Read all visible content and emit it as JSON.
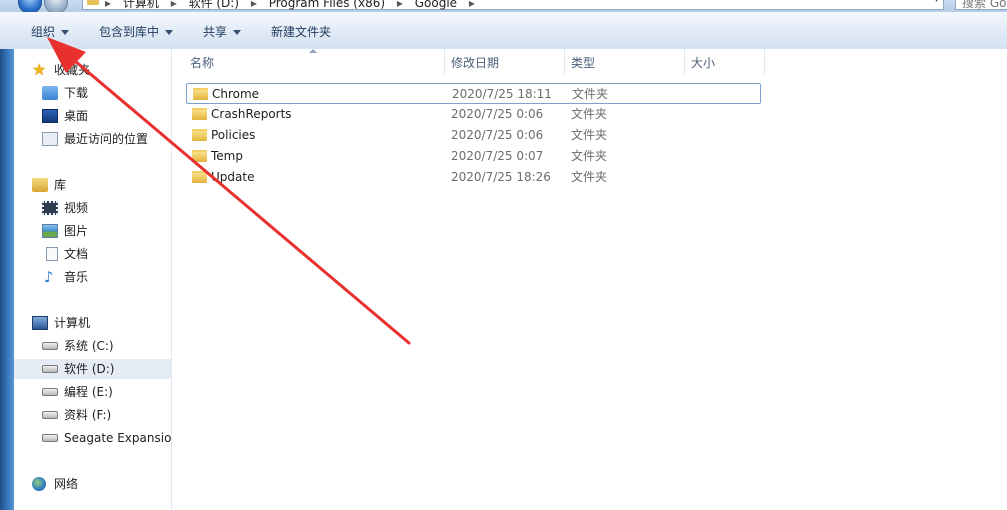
{
  "address": {
    "crumbs": [
      "计算机",
      "软件 (D:)",
      "Program Files (x86)",
      "Google"
    ],
    "separator": "▸"
  },
  "search": {
    "placeholder": "搜索 Go"
  },
  "toolbar": {
    "organize": "组织",
    "include_in_library": "包含到库中",
    "share": "共享",
    "new_folder": "新建文件夹"
  },
  "nav": {
    "favorites": "收藏夹",
    "downloads": "下载",
    "desktop": "桌面",
    "recent": "最近访问的位置",
    "libraries": "库",
    "videos": "视频",
    "pictures": "图片",
    "documents": "文档",
    "music": "音乐",
    "computer": "计算机",
    "drives": [
      {
        "label": "系统 (C:)"
      },
      {
        "label": "软件 (D:)"
      },
      {
        "label": "编程 (E:)"
      },
      {
        "label": "资料 (F:)"
      },
      {
        "label": "Seagate Expansion"
      }
    ],
    "network": "网络"
  },
  "columns": {
    "name": "名称",
    "modified": "修改日期",
    "type": "类型",
    "size": "大小"
  },
  "files": [
    {
      "name": "Chrome",
      "modified": "2020/7/25 18:11",
      "type": "文件夹"
    },
    {
      "name": "CrashReports",
      "modified": "2020/7/25 0:06",
      "type": "文件夹"
    },
    {
      "name": "Policies",
      "modified": "2020/7/25 0:06",
      "type": "文件夹"
    },
    {
      "name": "Temp",
      "modified": "2020/7/25 0:07",
      "type": "文件夹"
    },
    {
      "name": "Update",
      "modified": "2020/7/25 18:26",
      "type": "文件夹"
    }
  ],
  "colors": {
    "annotation_arrow": "#e8312f",
    "toolbar_text": "#1e395b",
    "selected_nav": "#e5ecf6"
  }
}
